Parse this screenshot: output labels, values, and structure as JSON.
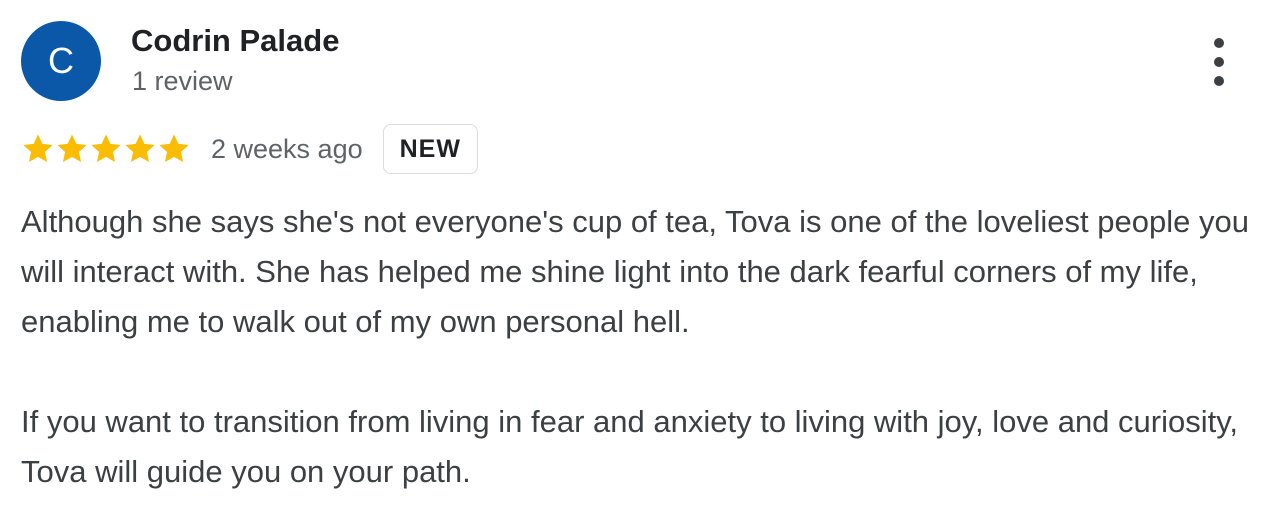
{
  "reviewer": {
    "avatar_initial": "C",
    "avatar_color": "#0b57a8",
    "name": "Codrin Palade",
    "review_count": "1 review"
  },
  "menu": {
    "icon": "more-vert-icon"
  },
  "rating": {
    "stars": 5,
    "max_stars": 5,
    "star_color": "#fbbc04",
    "date": "2 weeks ago",
    "badge": "NEW"
  },
  "review": {
    "paragraph_1": "Although she says she's not everyone's cup of tea, Tova is one of the loveliest people you will interact with. She has helped me shine light into the dark fearful corners of my life, enabling me to walk out of my own personal hell.",
    "paragraph_2": "If you want to transition from living in fear and anxiety to living with joy, love and curiosity, Tova will guide you on your path."
  }
}
